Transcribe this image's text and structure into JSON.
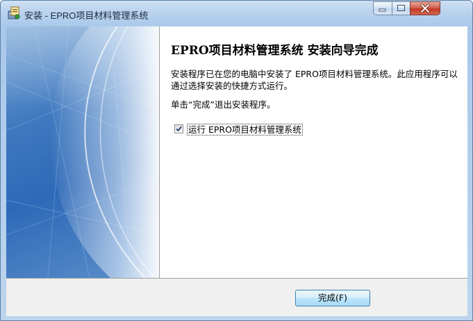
{
  "window": {
    "title": "安装 - EPRO项目材料管理系统",
    "icon": "installer-app-icon",
    "controls": {
      "minimize": "minimize-icon",
      "maximize": "maximize-icon",
      "close": "close-icon"
    }
  },
  "wizard": {
    "heading": "EPRO项目材料管理系统 安装向导完成",
    "paragraph1": "安装程序已在您的电脑中安装了 EPRO项目材料管理系统。此应用程序可以通过选择安装的快捷方式运行。",
    "paragraph2": "单击“完成”退出安装程序。",
    "run_checkbox": {
      "label": "运行 EPRO项目材料管理系统",
      "checked": true
    }
  },
  "buttons": {
    "finish": "完成(F)"
  },
  "colors": {
    "side_panel": "#3f78bf",
    "button_border": "#3c7fb1"
  }
}
